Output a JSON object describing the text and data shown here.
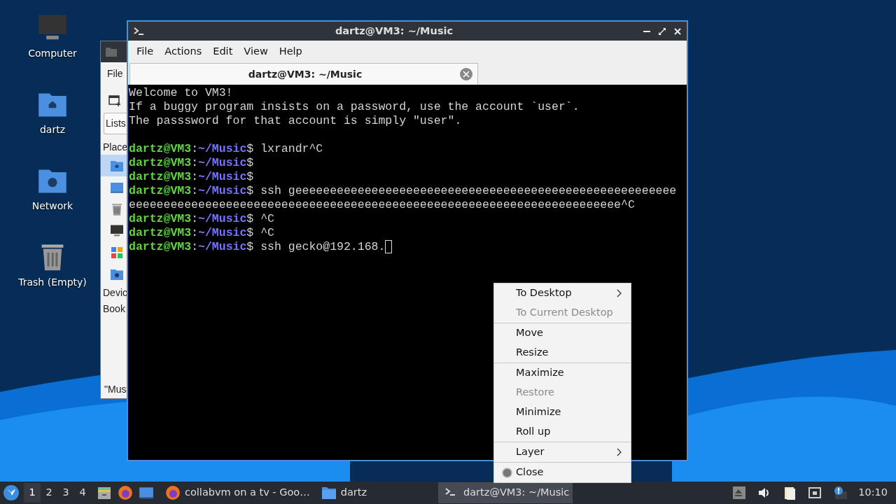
{
  "desktop_icons": [
    {
      "label": "Computer",
      "kind": "computer"
    },
    {
      "label": "dartz",
      "kind": "home"
    },
    {
      "label": "Network",
      "kind": "network"
    },
    {
      "label": "Trash (Empty)",
      "kind": "trash"
    }
  ],
  "file_manager": {
    "menu": "File",
    "tab": "Lists",
    "sidebar_heading": "Place",
    "sidebar_icons": [
      {
        "kind": "home",
        "selected": true
      },
      {
        "kind": "desktop",
        "selected": false
      },
      {
        "kind": "trash",
        "selected": false
      },
      {
        "kind": "computer",
        "selected": false
      },
      {
        "kind": "apps",
        "selected": false
      },
      {
        "kind": "network",
        "selected": false
      }
    ],
    "sections": [
      "Devic",
      "Book"
    ],
    "status": "\"Mus"
  },
  "terminal": {
    "title": "dartz@VM3: ~/Music",
    "menu": [
      "File",
      "Actions",
      "Edit",
      "View",
      "Help"
    ],
    "tabs": [
      {
        "label": "dartz@VM3: ~/Music",
        "selected": true
      }
    ],
    "lines": [
      [
        {
          "kind": "plain",
          "text": "Welcome to VM3!"
        }
      ],
      [
        {
          "kind": "plain",
          "text": "If a buggy program insists on a password, use the account `user`."
        }
      ],
      [
        {
          "kind": "plain",
          "text": "The passsword for that account is simply \"user\"."
        }
      ],
      [
        {
          "kind": "blank"
        }
      ],
      [
        {
          "kind": "user",
          "text": "dartz@VM3"
        },
        {
          "kind": "plain",
          "text": ":"
        },
        {
          "kind": "path",
          "text": "~/Music"
        },
        {
          "kind": "plain",
          "text": "$ lxrandr^C"
        }
      ],
      [
        {
          "kind": "user",
          "text": "dartz@VM3"
        },
        {
          "kind": "plain",
          "text": ":"
        },
        {
          "kind": "path",
          "text": "~/Music"
        },
        {
          "kind": "plain",
          "text": "$"
        }
      ],
      [
        {
          "kind": "user",
          "text": "dartz@VM3"
        },
        {
          "kind": "plain",
          "text": ":"
        },
        {
          "kind": "path",
          "text": "~/Music"
        },
        {
          "kind": "plain",
          "text": "$"
        }
      ],
      [
        {
          "kind": "user",
          "text": "dartz@VM3"
        },
        {
          "kind": "plain",
          "text": ":"
        },
        {
          "kind": "path",
          "text": "~/Music"
        },
        {
          "kind": "plain",
          "text": "$ ssh geeeeeeeeeeeeeeeeeeeeeeeeeeeeeeeeeeeeeeeeeeeeeeeeeeeeeee"
        }
      ],
      [
        {
          "kind": "plain",
          "text": "eeeeeeeeeeeeeeeeeeeeeeeeeeeeeeeeeeeeeeeeeeeeeeeeeeeeeeeeeeeeeeeeeeeeeee^C"
        }
      ],
      [
        {
          "kind": "user",
          "text": "dartz@VM3"
        },
        {
          "kind": "plain",
          "text": ":"
        },
        {
          "kind": "path",
          "text": "~/Music"
        },
        {
          "kind": "plain",
          "text": "$ ^C"
        }
      ],
      [
        {
          "kind": "user",
          "text": "dartz@VM3"
        },
        {
          "kind": "plain",
          "text": ":"
        },
        {
          "kind": "path",
          "text": "~/Music"
        },
        {
          "kind": "plain",
          "text": "$ ^C"
        }
      ],
      [
        {
          "kind": "user",
          "text": "dartz@VM3"
        },
        {
          "kind": "plain",
          "text": ":"
        },
        {
          "kind": "path",
          "text": "~/Music"
        },
        {
          "kind": "plain",
          "text": "$ ssh gecko@192.168."
        },
        {
          "kind": "cursor"
        }
      ]
    ]
  },
  "context_menu": {
    "groups": [
      [
        {
          "label": "To Desktop",
          "disabled": false,
          "submenu": true
        },
        {
          "label": "To Current Desktop",
          "disabled": true,
          "submenu": false
        }
      ],
      [
        {
          "label": "Move",
          "disabled": false,
          "submenu": false
        },
        {
          "label": "Resize",
          "disabled": false,
          "submenu": false
        }
      ],
      [
        {
          "label": "Maximize",
          "disabled": false,
          "submenu": false
        },
        {
          "label": "Restore",
          "disabled": true,
          "submenu": false
        },
        {
          "label": "Minimize",
          "disabled": false,
          "submenu": false
        },
        {
          "label": "Roll up",
          "disabled": false,
          "submenu": false
        }
      ],
      [
        {
          "label": "Layer",
          "disabled": false,
          "submenu": true
        }
      ],
      [
        {
          "label": "Close",
          "disabled": false,
          "submenu": false,
          "icon": true
        }
      ]
    ]
  },
  "taskbar": {
    "workspaces": [
      {
        "label": "1",
        "selected": true
      },
      {
        "label": "2",
        "selected": false
      },
      {
        "label": "3",
        "selected": false
      },
      {
        "label": "4",
        "selected": false
      }
    ],
    "launchers": [
      {
        "kind": "files"
      },
      {
        "kind": "firefox"
      },
      {
        "kind": "desktop"
      }
    ],
    "tasks": [
      {
        "label": "collabvm on a tv - Goo…",
        "kind": "firefox",
        "selected": false
      },
      {
        "label": "dartz",
        "kind": "folder",
        "selected": false
      },
      {
        "label": "dartz@VM3: ~/Music",
        "kind": "terminal",
        "selected": true
      }
    ],
    "tray": [
      {
        "kind": "eject"
      },
      {
        "kind": "volume"
      },
      {
        "kind": "notes"
      },
      {
        "kind": "network"
      },
      {
        "kind": "notification"
      }
    ],
    "clock": "10:10"
  }
}
